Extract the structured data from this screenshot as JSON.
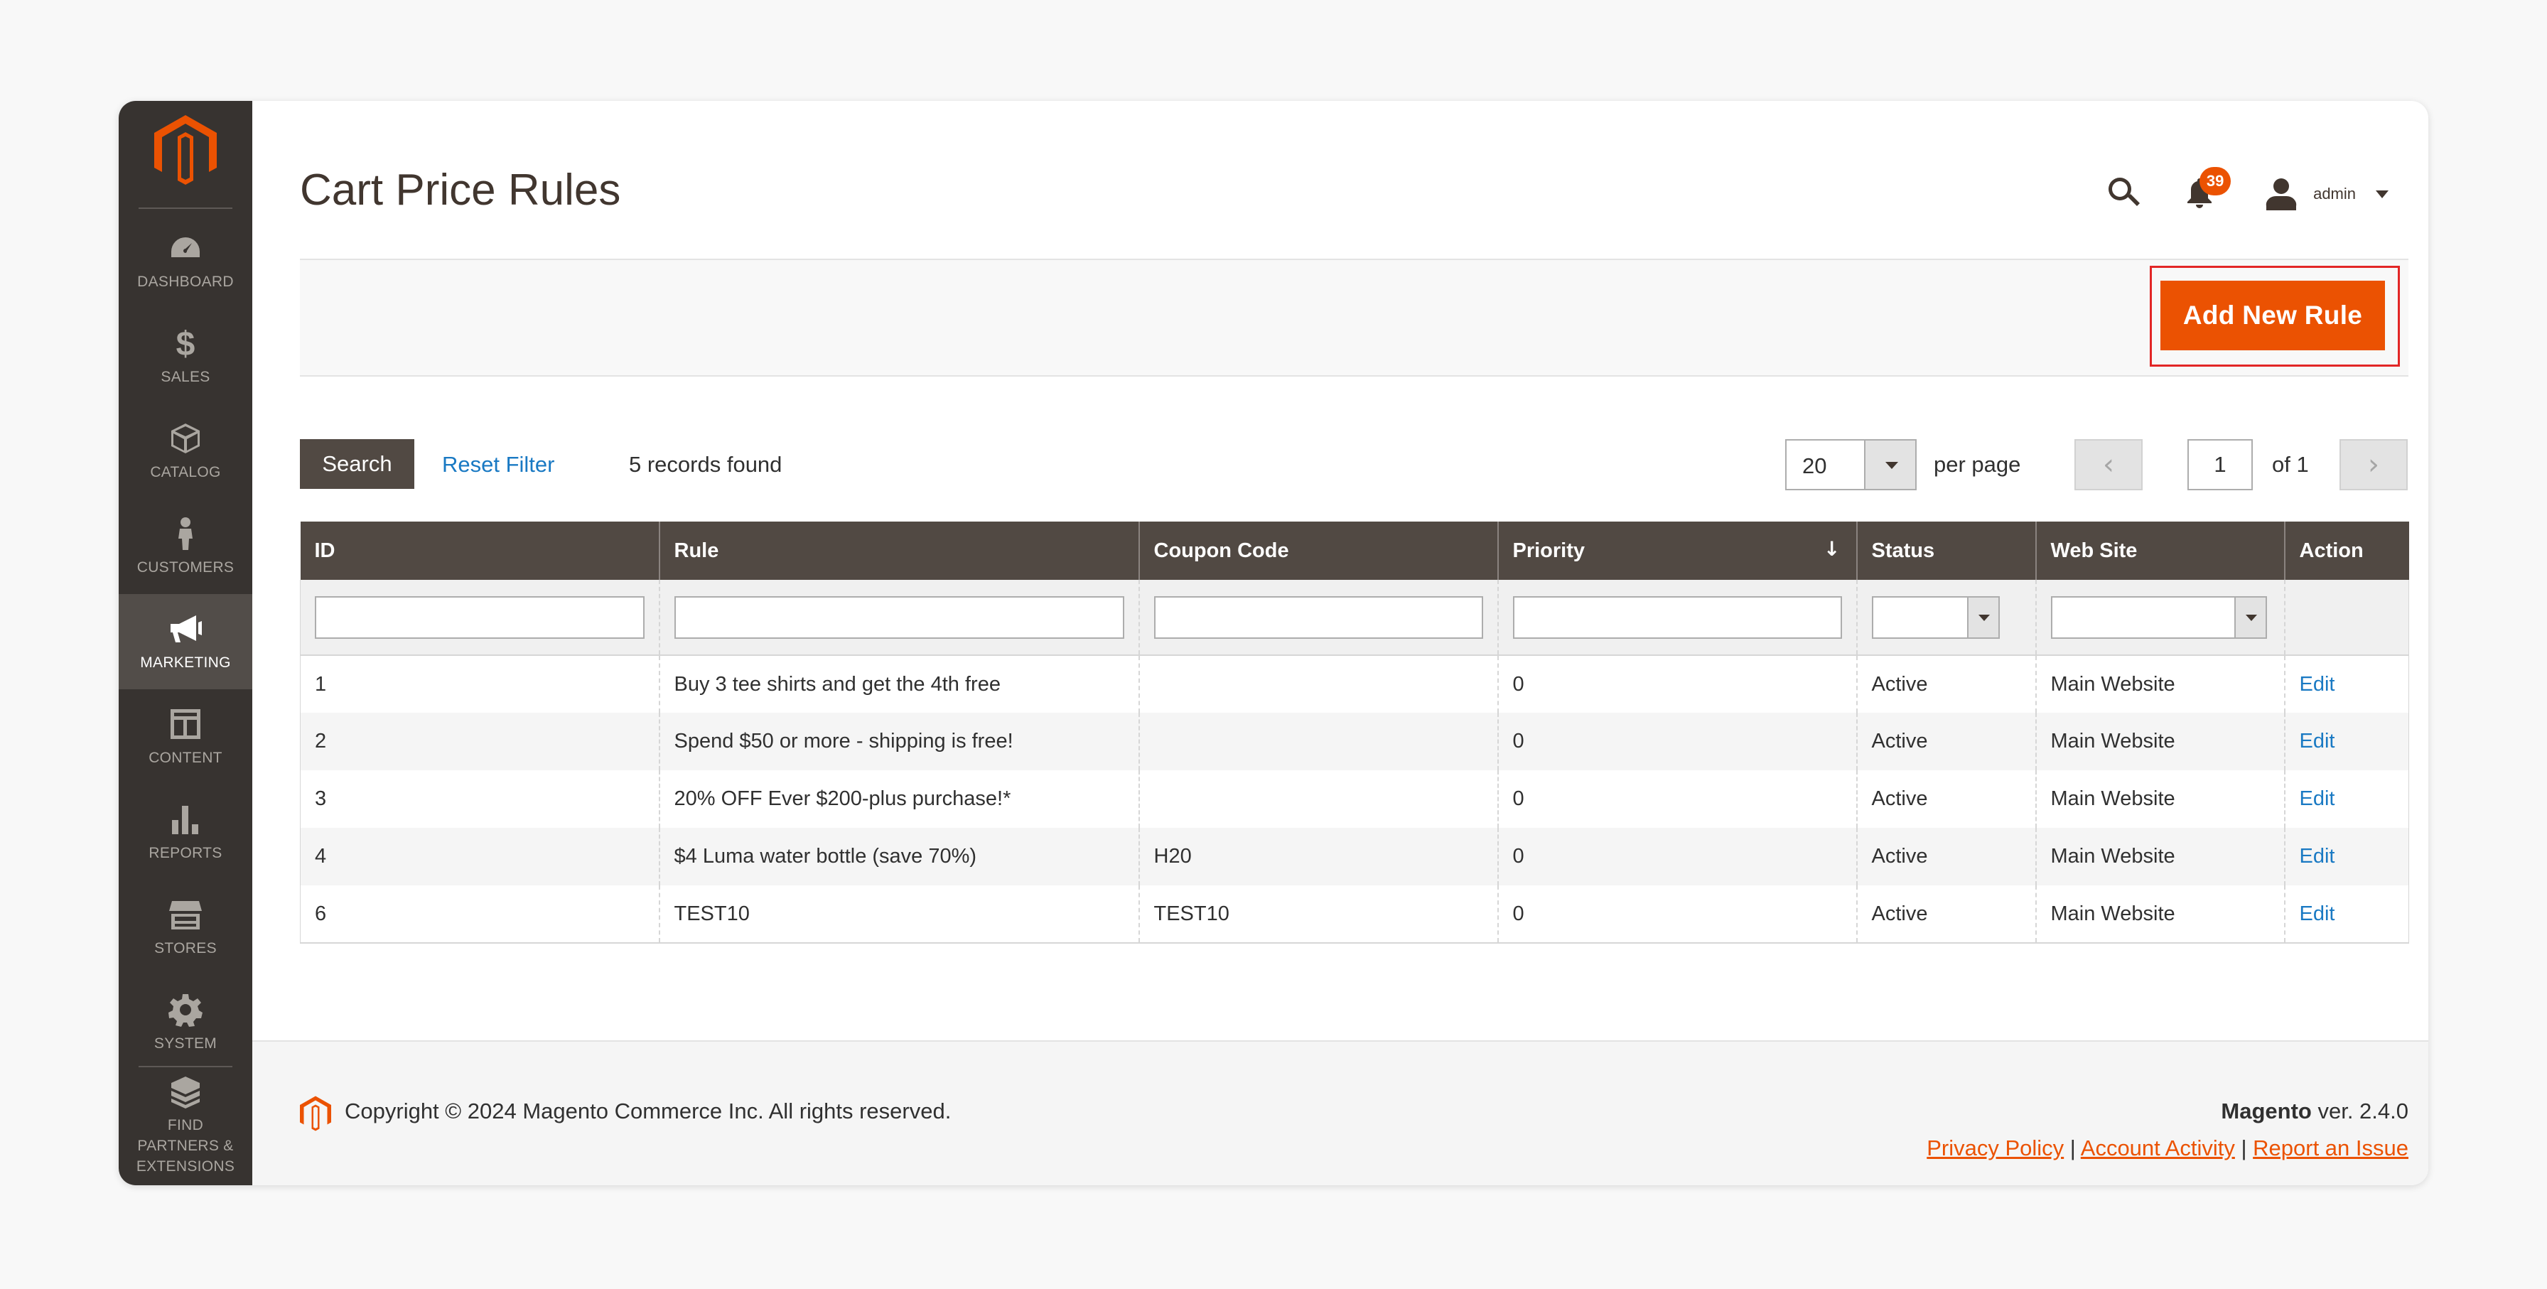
{
  "sidebar": {
    "items": [
      {
        "label": "DASHBOARD",
        "icon": "dashboard-icon"
      },
      {
        "label": "SALES",
        "icon": "dollar-icon"
      },
      {
        "label": "CATALOG",
        "icon": "box-icon"
      },
      {
        "label": "CUSTOMERS",
        "icon": "person-icon"
      },
      {
        "label": "MARKETING",
        "icon": "megaphone-icon",
        "active": true
      },
      {
        "label": "CONTENT",
        "icon": "layout-icon"
      },
      {
        "label": "REPORTS",
        "icon": "bar-chart-icon"
      },
      {
        "label": "STORES",
        "icon": "storefront-icon"
      },
      {
        "label": "SYSTEM",
        "icon": "gear-icon"
      },
      {
        "label": "FIND PARTNERS & EXTENSIONS",
        "icon": "blocks-icon"
      }
    ]
  },
  "header": {
    "title": "Cart Price Rules",
    "notifications_count": "39",
    "user_name": "admin"
  },
  "toolbar": {
    "add_label": "Add New Rule"
  },
  "grid_controls": {
    "search_label": "Search",
    "reset_label": "Reset Filter",
    "records_text": "5 records found",
    "per_page_value": "20",
    "per_page_label": "per page",
    "current_page": "1",
    "page_of": "of 1"
  },
  "table": {
    "columns": [
      "ID",
      "Rule",
      "Coupon Code",
      "Priority",
      "Status",
      "Web Site",
      "Action"
    ],
    "sort_indicator": "↓",
    "rows": [
      {
        "id": "1",
        "rule": "Buy 3 tee shirts and get the 4th free",
        "coupon": "",
        "priority": "0",
        "status": "Active",
        "website": "Main Website",
        "action": "Edit"
      },
      {
        "id": "2",
        "rule": "Spend $50 or more - shipping is free!",
        "coupon": "",
        "priority": "0",
        "status": "Active",
        "website": "Main Website",
        "action": "Edit"
      },
      {
        "id": "3",
        "rule": "20% OFF Ever $200-plus purchase!*",
        "coupon": "",
        "priority": "0",
        "status": "Active",
        "website": "Main Website",
        "action": "Edit"
      },
      {
        "id": "4",
        "rule": "$4 Luma water bottle (save 70%)",
        "coupon": "H20",
        "priority": "0",
        "status": "Active",
        "website": "Main Website",
        "action": "Edit"
      },
      {
        "id": "6",
        "rule": "TEST10",
        "coupon": "TEST10",
        "priority": "0",
        "status": "Active",
        "website": "Main Website",
        "action": "Edit"
      }
    ]
  },
  "footer": {
    "copyright": "Copyright © 2024 Magento Commerce Inc. All rights reserved.",
    "brand": "Magento",
    "version": " ver. 2.4.0",
    "links": [
      "Privacy Policy",
      " Account Activity",
      "Report an Issue"
    ],
    "separator": " | "
  },
  "colors": {
    "accent": "#eb5202",
    "sidebar_bg": "#373330",
    "table_header_bg": "#514943",
    "link": "#1979c3"
  }
}
